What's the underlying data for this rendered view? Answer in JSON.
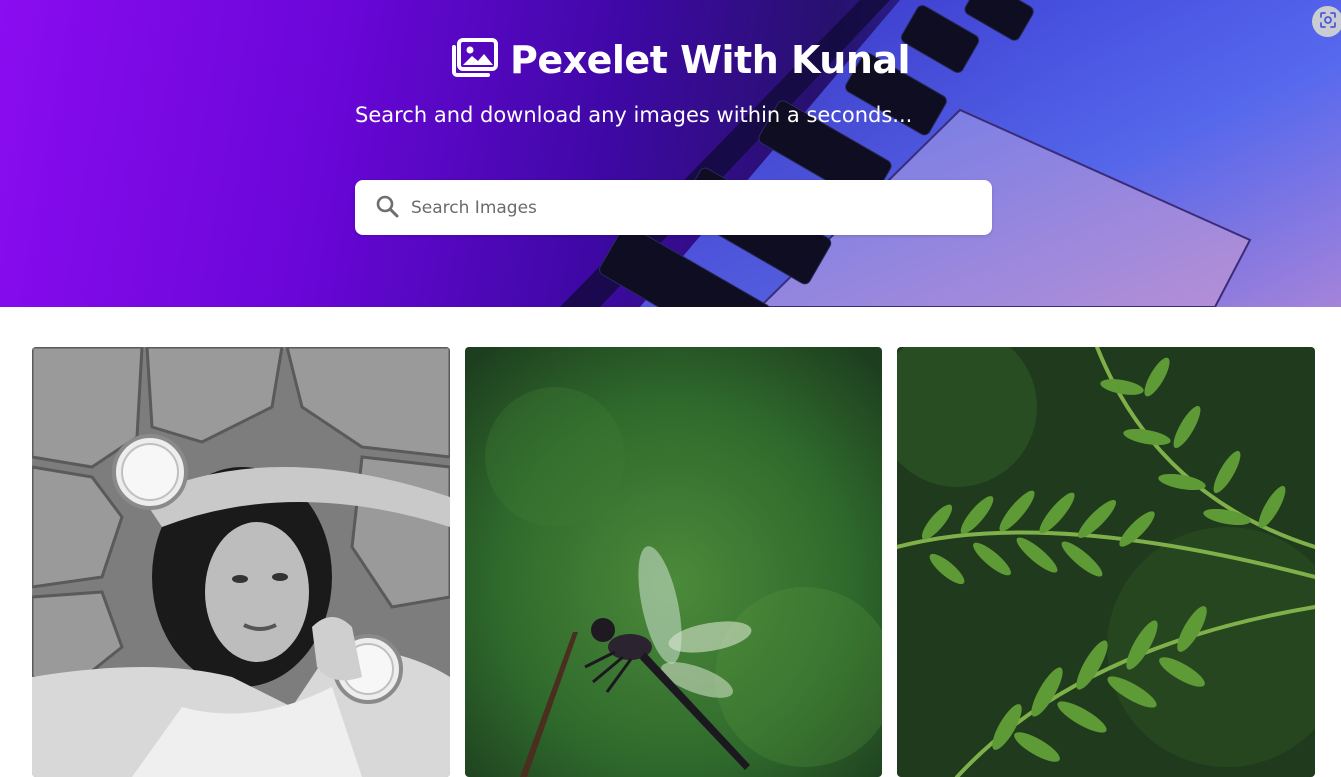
{
  "header": {
    "title": "Pexelet With Kunal",
    "tagline": "Search and download any images within a seconds..."
  },
  "search": {
    "placeholder": "Search Images",
    "value": ""
  },
  "icons": {
    "logo": "images-icon",
    "search": "search-icon",
    "corner_button": "lens-scan-icon"
  },
  "gallery": {
    "images": [
      {
        "description": "black and white woman holding lemon halves",
        "icon": "photo"
      },
      {
        "description": "dragonfly on twig with green background",
        "icon": "photo"
      },
      {
        "description": "green fern leaves",
        "icon": "photo"
      }
    ]
  },
  "colors": {
    "hero_start": "#8a0cf0",
    "hero_end": "#4a5fe8",
    "text_on_hero": "#ffffff",
    "search_bg": "#ffffff"
  }
}
